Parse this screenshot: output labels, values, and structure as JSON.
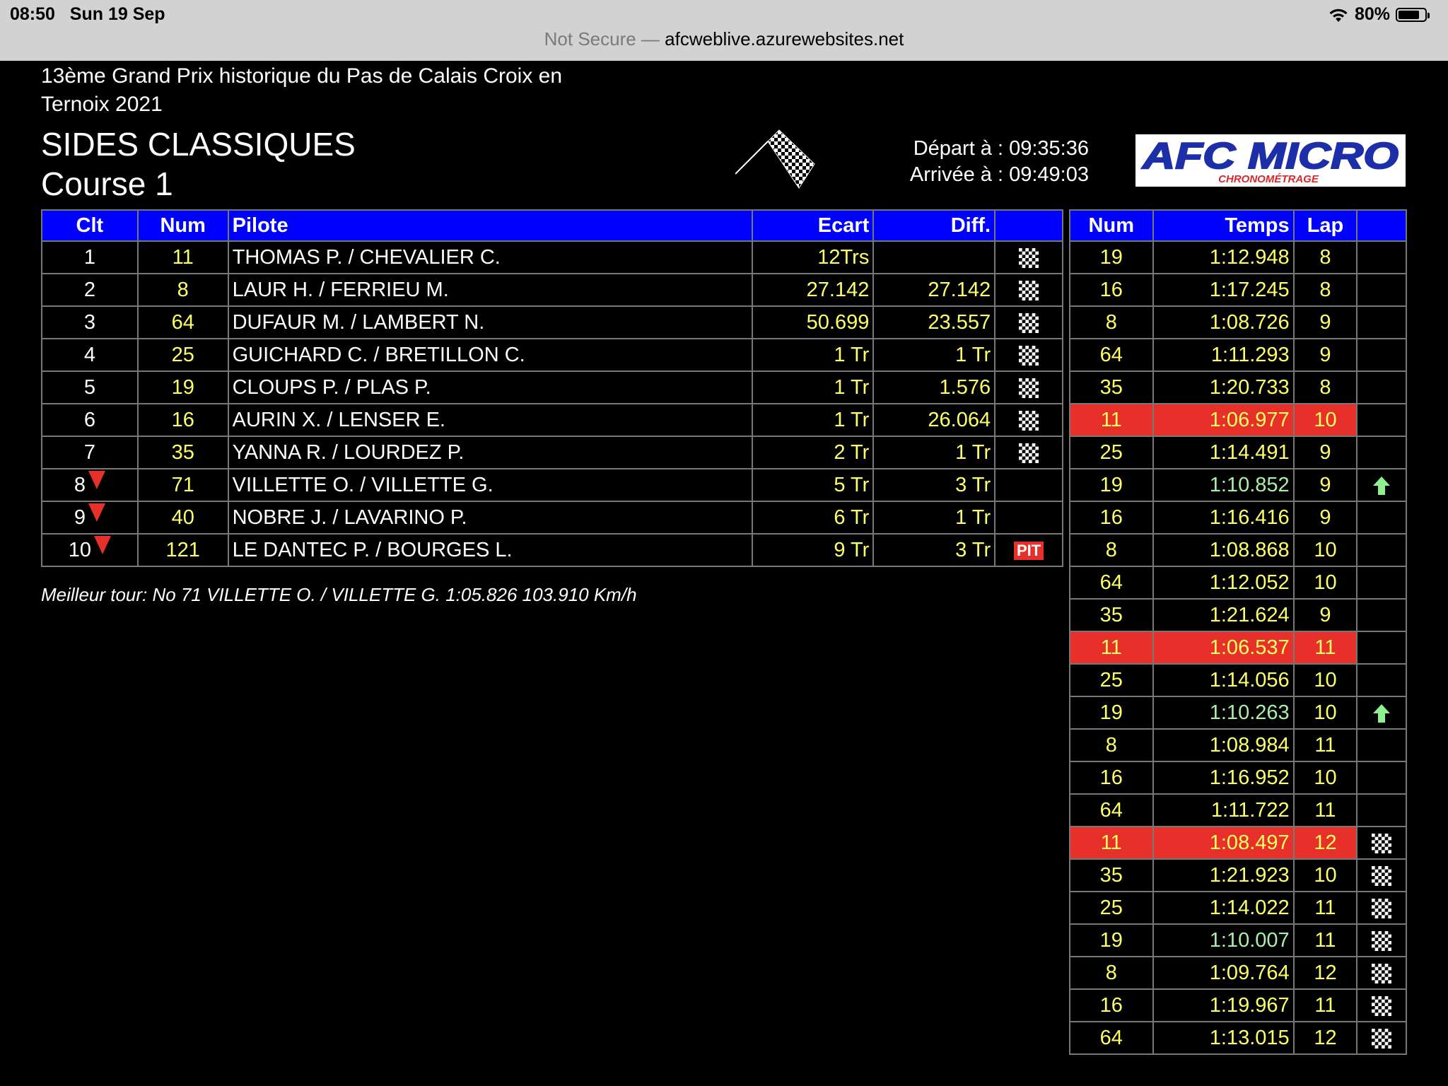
{
  "status": {
    "time": "08:50",
    "date": "Sun 19 Sep",
    "battery": "80%",
    "battery_level": 0.8,
    "url_prefix": "Not Secure — ",
    "url": "afcweblive.azurewebsites.net"
  },
  "header": {
    "event_title": "13ème Grand Prix historique du Pas de Calais Croix en Ternoix 2021",
    "category": "SIDES CLASSIQUES",
    "race": "Course 1",
    "depart": "Départ à : 09:35:36",
    "arrivee": "Arrivée à : 09:49:03",
    "logo_main": "AFC MICRO",
    "logo_sub": "CHRONOMÉTRAGE"
  },
  "results": {
    "columns": [
      "Clt",
      "Num",
      "Pilote",
      "Ecart",
      "Diff.",
      ""
    ],
    "rows": [
      {
        "clt": "1",
        "num": "11",
        "pilote": "THOMAS P. / CHEVALIER C.",
        "ecart": "12Trs",
        "diff": "",
        "status": "flag",
        "down": false
      },
      {
        "clt": "2",
        "num": "8",
        "pilote": "LAUR H. / FERRIEU M.",
        "ecart": "27.142",
        "diff": "27.142",
        "status": "flag",
        "down": false
      },
      {
        "clt": "3",
        "num": "64",
        "pilote": "DUFAUR M. / LAMBERT N.",
        "ecart": "50.699",
        "diff": "23.557",
        "status": "flag",
        "down": false
      },
      {
        "clt": "4",
        "num": "25",
        "pilote": "GUICHARD C. / BRETILLON C.",
        "ecart": "1 Tr",
        "diff": "1 Tr",
        "status": "flag",
        "down": false
      },
      {
        "clt": "5",
        "num": "19",
        "pilote": "CLOUPS P. / PLAS P.",
        "ecart": "1 Tr",
        "diff": "1.576",
        "status": "flag",
        "down": false
      },
      {
        "clt": "6",
        "num": "16",
        "pilote": "AURIN X. / LENSER E.",
        "ecart": "1 Tr",
        "diff": "26.064",
        "status": "flag",
        "down": false
      },
      {
        "clt": "7",
        "num": "35",
        "pilote": "YANNA R. / LOURDEZ P.",
        "ecart": "2 Tr",
        "diff": "1 Tr",
        "status": "flag",
        "down": false
      },
      {
        "clt": "8",
        "num": "71",
        "pilote": "VILLETTE O. / VILLETTE G.",
        "ecart": "5 Tr",
        "diff": "3 Tr",
        "status": "",
        "down": true
      },
      {
        "clt": "9",
        "num": "40",
        "pilote": "NOBRE J. / LAVARINO P.",
        "ecart": "6 Tr",
        "diff": "1 Tr",
        "status": "",
        "down": true
      },
      {
        "clt": "10",
        "num": "121",
        "pilote": "LE DANTEC P. / BOURGES L.",
        "ecart": "9 Tr",
        "diff": "3 Tr",
        "status": "pit",
        "down": true
      }
    ],
    "pit_label": "PIT",
    "best_lap": "Meilleur tour: No 71 VILLETTE O. / VILLETTE G. 1:05.826 103.910 Km/h"
  },
  "laps": {
    "columns": [
      "Num",
      "Temps",
      "Lap",
      ""
    ],
    "rows": [
      {
        "num": "19",
        "time": "1:12.948",
        "lap": "8",
        "mark": "",
        "best": false,
        "pb": false
      },
      {
        "num": "16",
        "time": "1:17.245",
        "lap": "8",
        "mark": "",
        "best": false,
        "pb": false
      },
      {
        "num": "8",
        "time": "1:08.726",
        "lap": "9",
        "mark": "",
        "best": false,
        "pb": false
      },
      {
        "num": "64",
        "time": "1:11.293",
        "lap": "9",
        "mark": "",
        "best": false,
        "pb": false
      },
      {
        "num": "35",
        "time": "1:20.733",
        "lap": "8",
        "mark": "",
        "best": false,
        "pb": false
      },
      {
        "num": "11",
        "time": "1:06.977",
        "lap": "10",
        "mark": "",
        "best": true,
        "pb": false
      },
      {
        "num": "25",
        "time": "1:14.491",
        "lap": "9",
        "mark": "",
        "best": false,
        "pb": false
      },
      {
        "num": "19",
        "time": "1:10.852",
        "lap": "9",
        "mark": "up",
        "best": false,
        "pb": true
      },
      {
        "num": "16",
        "time": "1:16.416",
        "lap": "9",
        "mark": "",
        "best": false,
        "pb": false
      },
      {
        "num": "8",
        "time": "1:08.868",
        "lap": "10",
        "mark": "",
        "best": false,
        "pb": false
      },
      {
        "num": "64",
        "time": "1:12.052",
        "lap": "10",
        "mark": "",
        "best": false,
        "pb": false
      },
      {
        "num": "35",
        "time": "1:21.624",
        "lap": "9",
        "mark": "",
        "best": false,
        "pb": false
      },
      {
        "num": "11",
        "time": "1:06.537",
        "lap": "11",
        "mark": "",
        "best": true,
        "pb": false
      },
      {
        "num": "25",
        "time": "1:14.056",
        "lap": "10",
        "mark": "",
        "best": false,
        "pb": false
      },
      {
        "num": "19",
        "time": "1:10.263",
        "lap": "10",
        "mark": "up",
        "best": false,
        "pb": true
      },
      {
        "num": "8",
        "time": "1:08.984",
        "lap": "11",
        "mark": "",
        "best": false,
        "pb": false
      },
      {
        "num": "16",
        "time": "1:16.952",
        "lap": "10",
        "mark": "",
        "best": false,
        "pb": false
      },
      {
        "num": "64",
        "time": "1:11.722",
        "lap": "11",
        "mark": "",
        "best": false,
        "pb": false
      },
      {
        "num": "11",
        "time": "1:08.497",
        "lap": "12",
        "mark": "flag",
        "best": true,
        "pb": false
      },
      {
        "num": "35",
        "time": "1:21.923",
        "lap": "10",
        "mark": "flag",
        "best": false,
        "pb": false
      },
      {
        "num": "25",
        "time": "1:14.022",
        "lap": "11",
        "mark": "flag",
        "best": false,
        "pb": false
      },
      {
        "num": "19",
        "time": "1:10.007",
        "lap": "11",
        "mark": "flag",
        "best": false,
        "pb": true
      },
      {
        "num": "8",
        "time": "1:09.764",
        "lap": "12",
        "mark": "flag",
        "best": false,
        "pb": false
      },
      {
        "num": "16",
        "time": "1:19.967",
        "lap": "11",
        "mark": "flag",
        "best": false,
        "pb": false
      },
      {
        "num": "64",
        "time": "1:13.015",
        "lap": "12",
        "mark": "flag",
        "best": false,
        "pb": false
      }
    ]
  },
  "colors": {
    "header_blue": "#0000ff",
    "best_red": "#e8302a",
    "value_yellow": "#ffff66",
    "pb_green": "#a8f0a8"
  }
}
